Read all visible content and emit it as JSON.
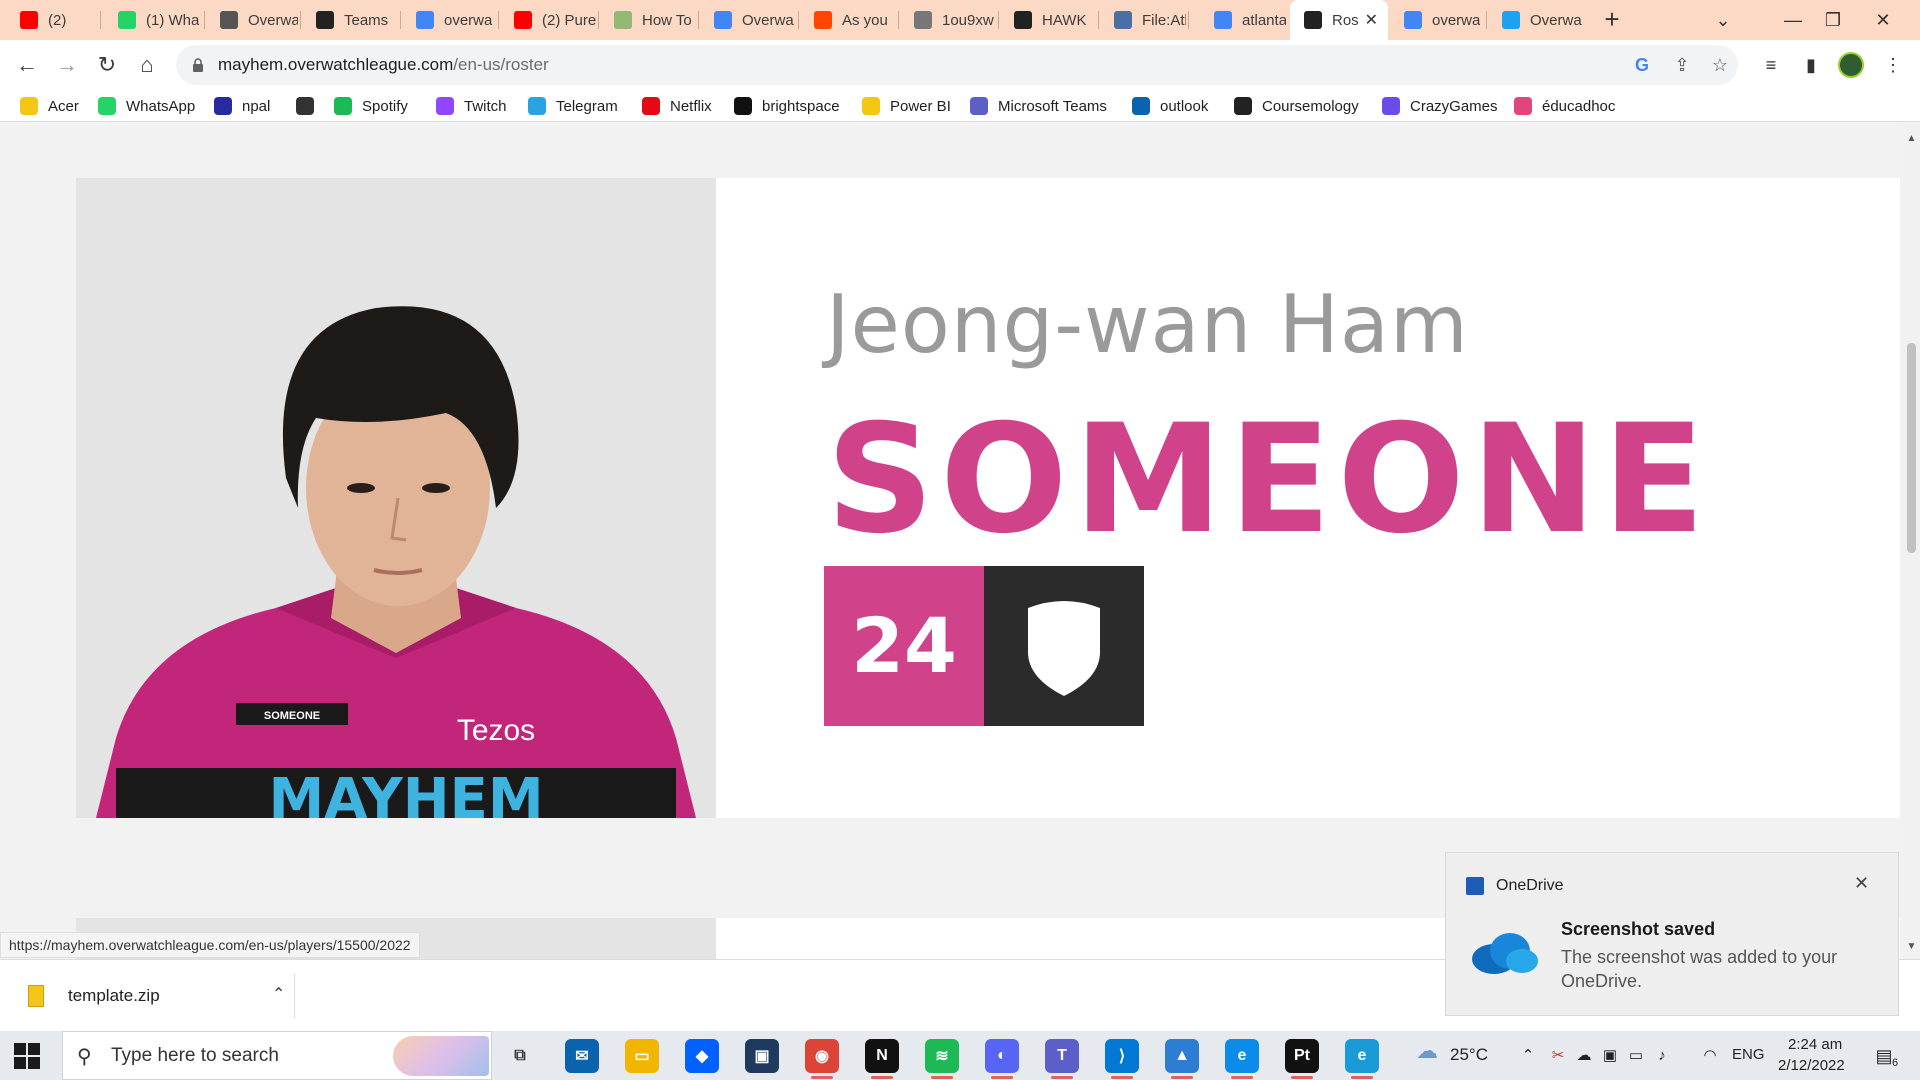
{
  "browser": {
    "tabs": [
      {
        "label": "(2)",
        "icon": "youtube-icon",
        "color": "#ff0000"
      },
      {
        "label": "(1) Wha",
        "icon": "whatsapp-icon",
        "color": "#25d366"
      },
      {
        "label": "Overwa",
        "icon": "overwatch-icon",
        "color": "#555555"
      },
      {
        "label": "Teams",
        "icon": "team-logo-icon",
        "color": "#222222"
      },
      {
        "label": "overwa",
        "icon": "google-icon",
        "color": "#4285f4"
      },
      {
        "label": "(2) Pure",
        "icon": "youtube-icon",
        "color": "#ff0000"
      },
      {
        "label": "How To",
        "icon": "wikihow-icon",
        "color": "#93b874"
      },
      {
        "label": "Overwa",
        "icon": "google-icon",
        "color": "#4285f4"
      },
      {
        "label": "As you",
        "icon": "reddit-icon",
        "color": "#ff4500"
      },
      {
        "label": "1ou9xw",
        "icon": "globe-icon",
        "color": "#777777"
      },
      {
        "label": "HAWK",
        "icon": "team-logo-icon",
        "color": "#222222"
      },
      {
        "label": "File:Atl",
        "icon": "wiki-icon",
        "color": "#4a6fa5"
      },
      {
        "label": "atlanta",
        "icon": "google-icon",
        "color": "#4285f4"
      },
      {
        "label": "Ros",
        "icon": "team-logo-icon",
        "color": "#222222",
        "active": true
      },
      {
        "label": "overwa",
        "icon": "google-icon",
        "color": "#4285f4"
      },
      {
        "label": "Overwa",
        "icon": "twitter-icon",
        "color": "#1da1f2"
      }
    ],
    "url_host": "mayhem.overwatchleague.com",
    "url_path": "/en-us/roster",
    "bookmarks": [
      {
        "label": "Acer",
        "icon": "folder-icon",
        "color": "#f5c518"
      },
      {
        "label": "WhatsApp",
        "icon": "whatsapp-icon",
        "color": "#25d366"
      },
      {
        "label": "npal",
        "icon": "npal-icon",
        "color": "#2a2aa0"
      },
      {
        "label": "",
        "icon": "globe-icon",
        "color": "#333333"
      },
      {
        "label": "Spotify",
        "icon": "spotify-icon",
        "color": "#1db954"
      },
      {
        "label": "Twitch",
        "icon": "twitch-icon",
        "color": "#9146ff"
      },
      {
        "label": "Telegram",
        "icon": "telegram-icon",
        "color": "#2aa3de"
      },
      {
        "label": "Netflix",
        "icon": "netflix-icon",
        "color": "#e50914"
      },
      {
        "label": "brightspace",
        "icon": "np-icon",
        "color": "#111111"
      },
      {
        "label": "Power BI",
        "icon": "powerbi-icon",
        "color": "#f2c811"
      },
      {
        "label": "Microsoft Teams",
        "icon": "teams-icon",
        "color": "#5b5fc7"
      },
      {
        "label": "outlook",
        "icon": "outlook-icon",
        "color": "#0a64ad"
      },
      {
        "label": "Coursemology",
        "icon": "coursemology-icon",
        "color": "#222222"
      },
      {
        "label": "CrazyGames",
        "icon": "crazygames-icon",
        "color": "#6b4ce6"
      },
      {
        "label": "éducadhoc",
        "icon": "educadhoc-icon",
        "color": "#e0457b"
      }
    ]
  },
  "player": {
    "real_name": "Jeong-wan Ham",
    "handle": "SOMEONE",
    "number": "24",
    "role_icon": "tank-shield-icon",
    "jersey_name": "SOMEONE",
    "jersey_sponsor": "Tezos",
    "jersey_team": "MAYHEM",
    "accent_color": "#d0428a"
  },
  "status_bar": {
    "hover_url": "https://mayhem.overwatchleague.com/en-us/players/15500/2022"
  },
  "downloads": {
    "file_name": "template.zip"
  },
  "toast": {
    "app": "OneDrive",
    "title": "Screenshot saved",
    "body": "The screenshot was added to your OneDrive."
  },
  "taskbar": {
    "search_placeholder": "Type here to search",
    "weather": "25°C",
    "language": "ENG",
    "time": "2:24 am",
    "date": "2/12/2022",
    "notification_count": "6",
    "apps": [
      {
        "name": "task-view-icon",
        "color": "#3a3a3a",
        "glyph": "⧉"
      },
      {
        "name": "mail-icon",
        "color": "#0a64ad",
        "glyph": "✉"
      },
      {
        "name": "file-explorer-icon",
        "color": "#f2b600",
        "glyph": "▭"
      },
      {
        "name": "dropbox-icon",
        "color": "#0061fe",
        "glyph": "◆"
      },
      {
        "name": "notion-app-icon",
        "color": "#1f3a5f",
        "glyph": "▣"
      },
      {
        "name": "chrome-icon",
        "color": "#db4437",
        "glyph": "◉"
      },
      {
        "name": "netflix-icon",
        "color": "#111111",
        "glyph": "N"
      },
      {
        "name": "spotify-icon",
        "color": "#1db954",
        "glyph": "≋"
      },
      {
        "name": "discord-icon",
        "color": "#5865f2",
        "glyph": "◐"
      },
      {
        "name": "teams-icon",
        "color": "#5b5fc7",
        "glyph": "T"
      },
      {
        "name": "vscode-icon",
        "color": "#0078d4",
        "glyph": "⟩"
      },
      {
        "name": "photos-icon",
        "color": "#2d7dd2",
        "glyph": "▲"
      },
      {
        "name": "edge-icon",
        "color": "#0c8ce9",
        "glyph": "e"
      },
      {
        "name": "pycharm-icon",
        "color": "#111111",
        "glyph": "Pt"
      },
      {
        "name": "edge-beta-icon",
        "color": "#1a9ad6",
        "glyph": "e"
      }
    ]
  }
}
